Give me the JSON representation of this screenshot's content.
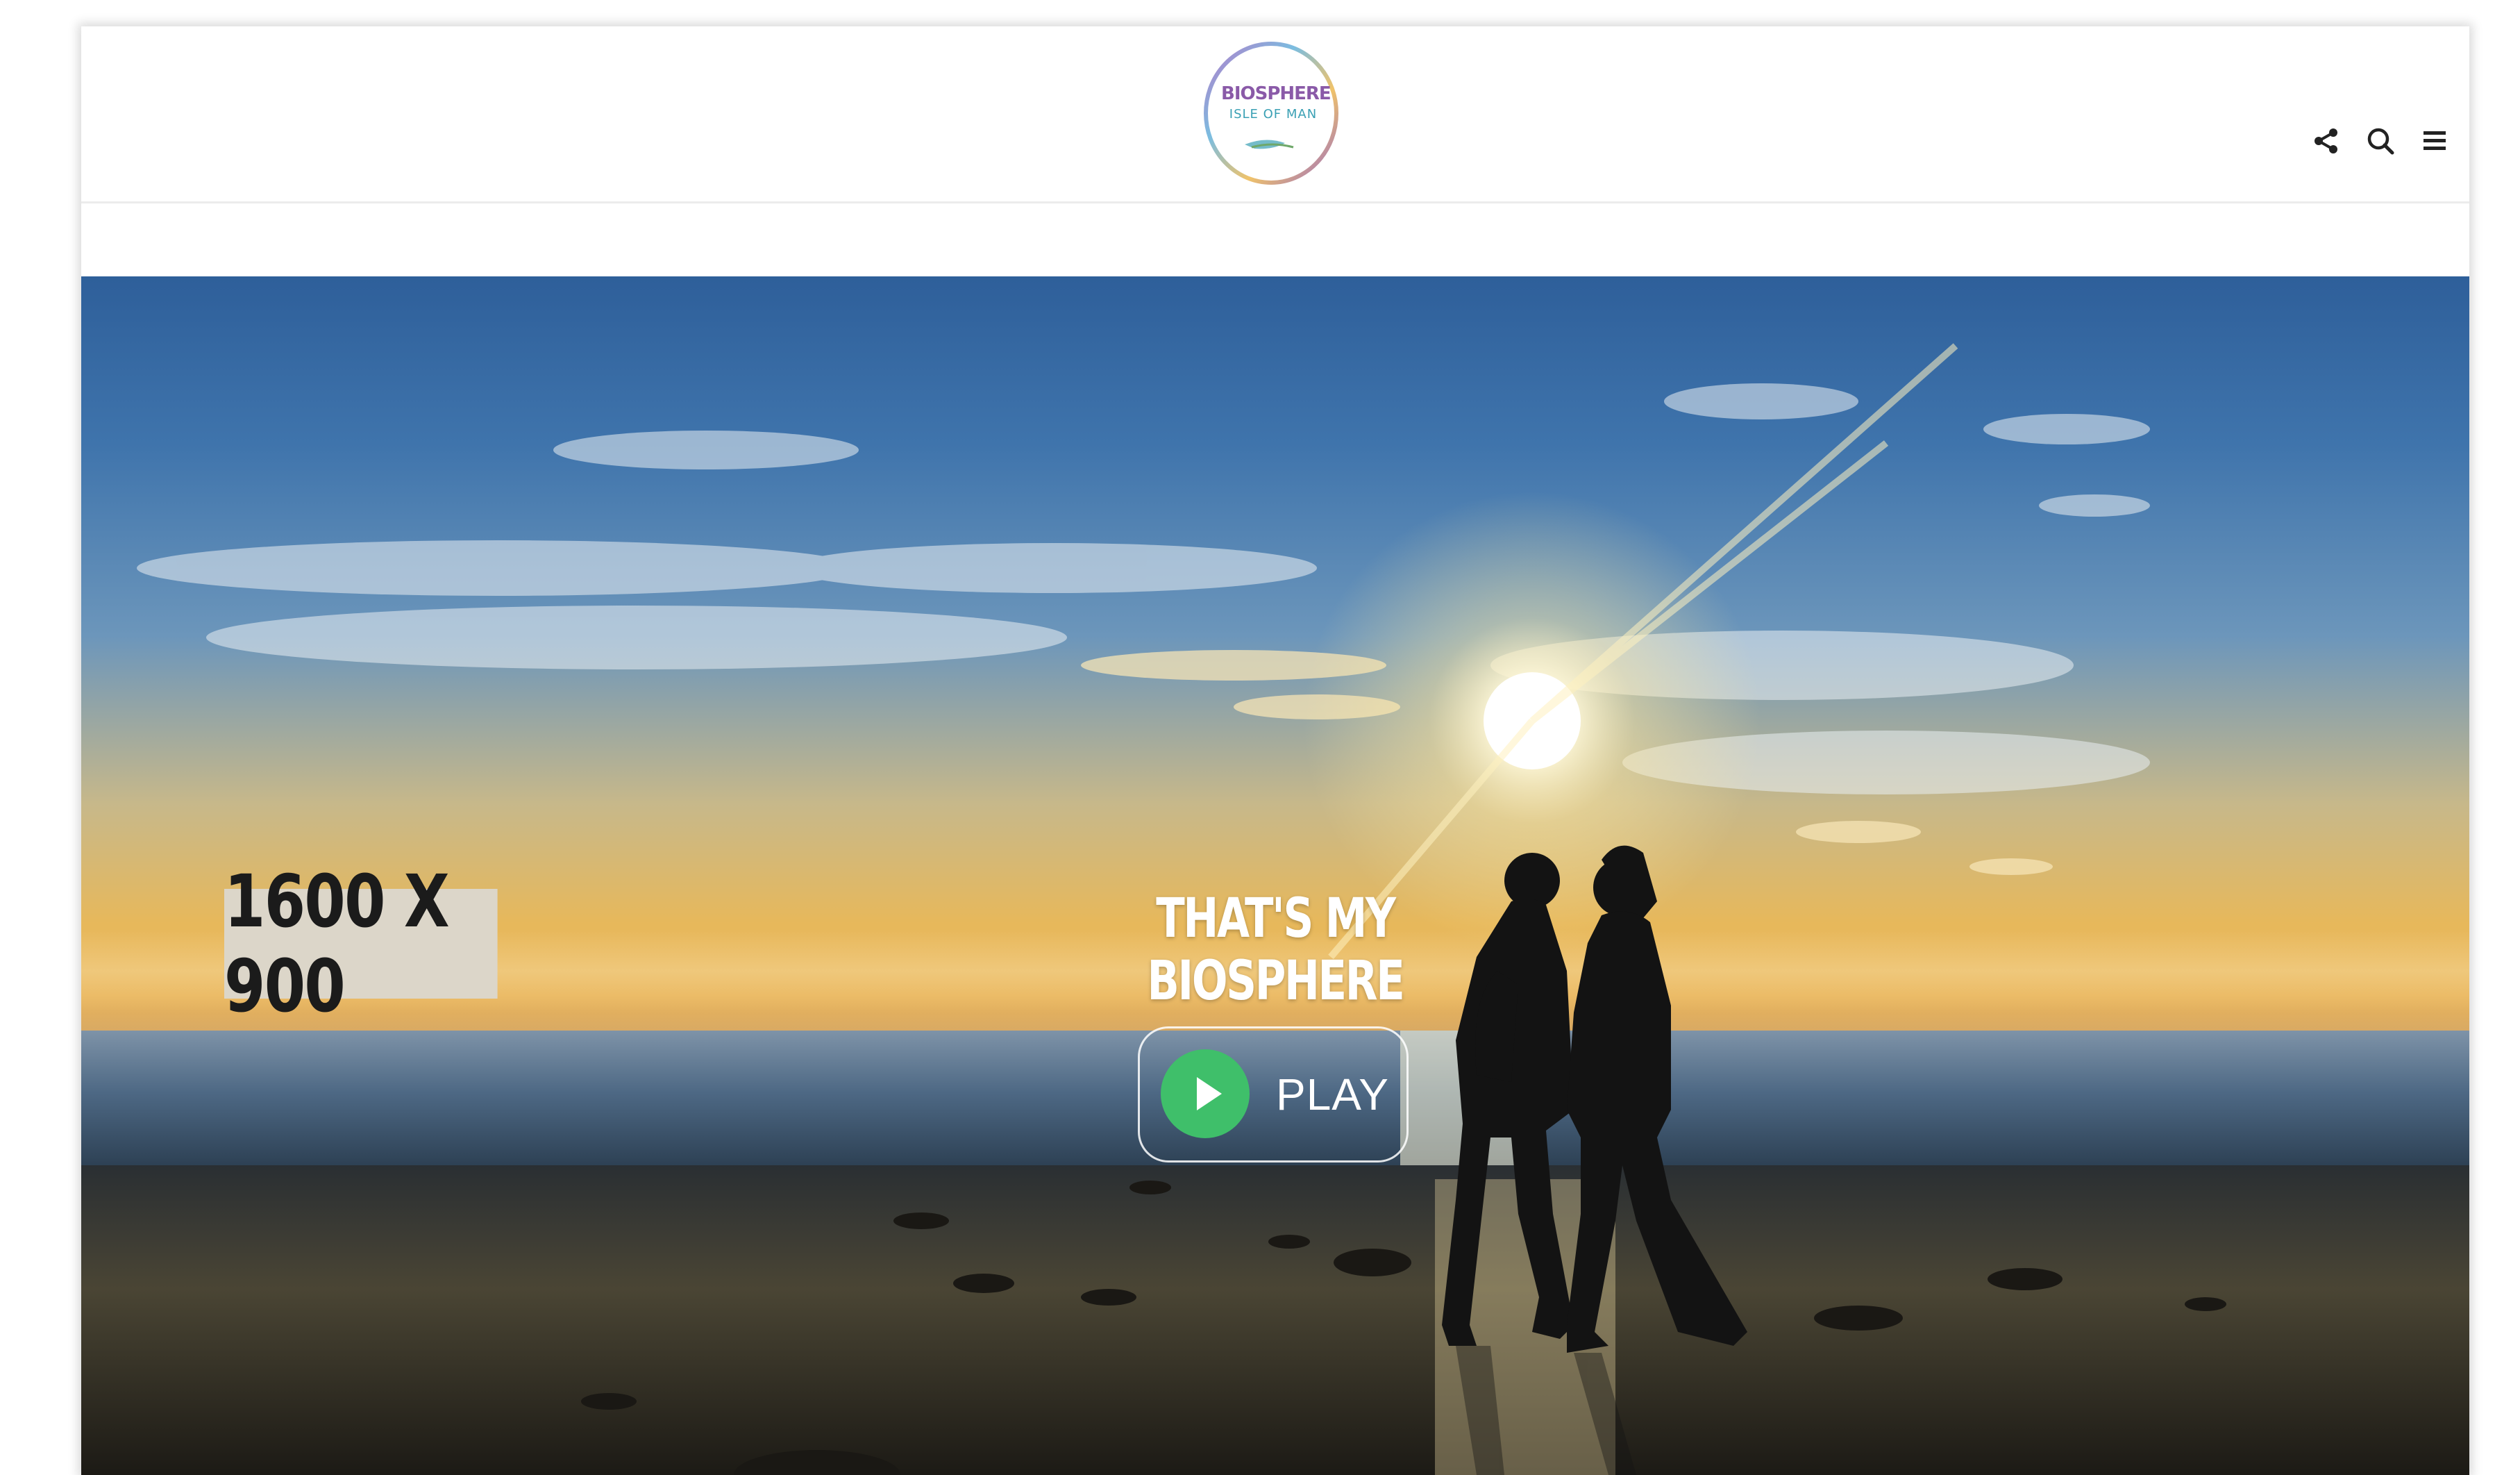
{
  "header": {
    "logo": {
      "line1": "BIOSPHERE",
      "line2": "ISLE OF MAN"
    },
    "icons": [
      "share-icon",
      "search-icon",
      "menu-icon"
    ]
  },
  "hero": {
    "placeholder_size": "1600 X 900",
    "title": "THAT'S MY BIOSPHERE",
    "play_label": "PLAY"
  },
  "colors": {
    "play_green": "#3fbf6a",
    "header_bg": "#ffffff",
    "logo_purple": "#8a5aa8",
    "logo_teal": "#3aa0b4"
  }
}
